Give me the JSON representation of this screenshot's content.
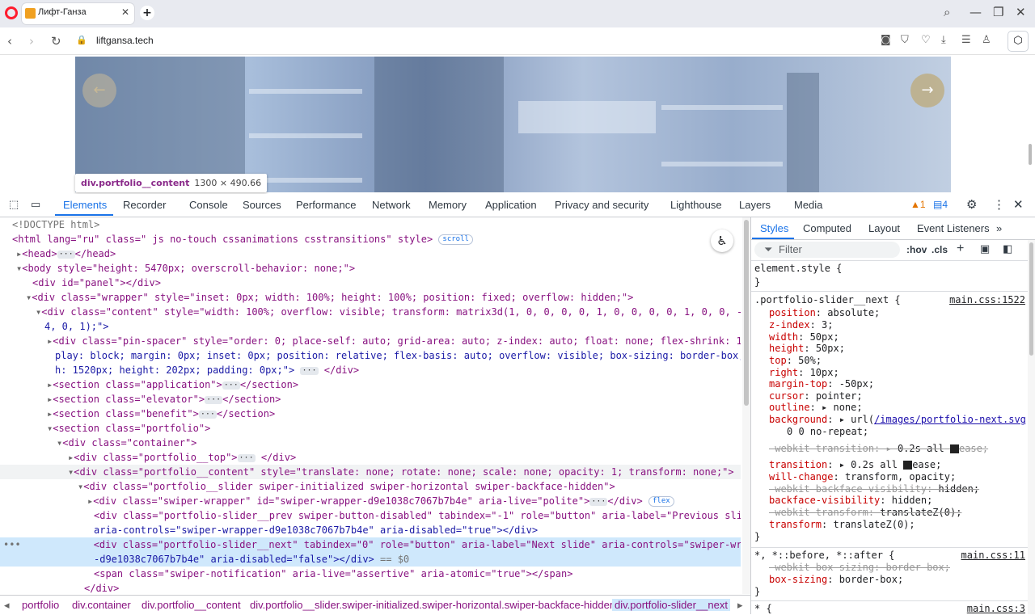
{
  "browser": {
    "tab_title": "Лифт-Ганза",
    "url": "liftgansa.tech",
    "new_tab": "+",
    "close_tab": "✕"
  },
  "page": {
    "tooltip_selector": "div.portfolio__content",
    "tooltip_size": "1300 × 490.66"
  },
  "devtools": {
    "tabs": [
      "Elements",
      "Recorder",
      "Console",
      "Sources",
      "Performance",
      "Network",
      "Memory",
      "Application",
      "Privacy and security",
      "Lighthouse",
      "Layers",
      "Media"
    ],
    "warnings_count": "1",
    "messages_count": "4",
    "breadcrumbs": [
      "portfolio",
      "div.container",
      "div.portfolio__content",
      "div.portfolio__slider.swiper-initialized.swiper-horizontal.swiper-backface-hidden",
      "div.portfolio-slider__next"
    ],
    "side_tabs": [
      "Styles",
      "Computed",
      "Layout",
      "Event Listeners"
    ],
    "filter_placeholder": "Filter",
    "hov": ":hov",
    "cls": ".cls",
    "dom_lines": [
      "<!DOCTYPE html>",
      "<html lang=\"ru\" class=\" js no-touch cssanimations csstransitions\" style>",
      "<head>",
      "</head>",
      "<body style=\"height: 5470px; overscroll-behavior: none;\">",
      "<div id=\"panel\"></div>",
      "<div class=\"wrapper\" style=\"inset: 0px; width: 100%; height: 100%; position: fixed; overflow: hidden;\">",
      "<div class=\"content\" style=\"width: 100%; overflow: visible; transform: matrix3d(1, 0, 0, 0, 0, 1, 0, 0, 0, 0, 1, 0, 0, -4254.",
      "4, 0, 1);\">",
      "<div class=\"pin-spacer\" style=\"order: 0; place-self: auto; grid-area: auto; z-index: auto; float: none; flex-shrink: 1; dis",
      "play: block; margin: 0px; inset: 0px; position: relative; flex-basis: auto; overflow: visible; box-sizing: border-box; widt",
      "h: 1520px; height: 202px; padding: 0px;\">",
      "</div>",
      "<section class=\"application\">",
      "</section>",
      "<section class=\"elevator\">",
      "</section>",
      "<section class=\"benefit\">",
      "</section>",
      "<section class=\"portfolio\">",
      "<div class=\"container\">",
      "<div class=\"portfolio__top\">",
      "</div>",
      "<div class=\"portfolio__content\" style=\"translate: none; rotate: none; scale: none; opacity: 1; transform: none;\">",
      "<div class=\"portfolio__slider swiper-initialized swiper-horizontal swiper-backface-hidden\">",
      "<div class=\"swiper-wrapper\" id=\"swiper-wrapper-d9e1038c7067b7b4e\" aria-live=\"polite\">",
      "</div>",
      "flex",
      "<div class=\"portfolio-slider__prev swiper-button-disabled\" tabindex=\"-1\" role=\"button\" aria-label=\"Previous slide\"",
      "aria-controls=\"swiper-wrapper-d9e1038c7067b7b4e\" aria-disabled=\"true\"></div>",
      "<div class=\"portfolio-slider__next\" tabindex=\"0\" role=\"button\" aria-label=\"Next slide\" aria-controls=\"swiper-wrapper",
      "-d9e1038c7067b7b4e\" aria-disabled=\"false\"></div>",
      "== $0",
      "<span class=\"swiper-notification\" aria-live=\"assertive\" aria-atomic=\"true\"></span>",
      "</div>",
      "scroll",
      "···"
    ],
    "styles": {
      "element_style": "element.style {",
      "rule1_selector": ".portfolio-slider__next {",
      "rule1_source": "main.css:1522",
      "rule1_props": [
        [
          "position",
          "absolute;"
        ],
        [
          "z-index",
          "3;"
        ],
        [
          "width",
          "50px;"
        ],
        [
          "height",
          "50px;"
        ],
        [
          "top",
          "50%;"
        ],
        [
          "right",
          "10px;"
        ],
        [
          "margin-top",
          "-50px;"
        ],
        [
          "cursor",
          "pointer;"
        ],
        [
          "outline",
          "none;"
        ],
        [
          "background",
          "url("
        ],
        [
          "-webkit-transition",
          "0.2s all"
        ],
        [
          "transition",
          "0.2s all"
        ],
        [
          "will-change",
          "transform, opacity;"
        ],
        [
          "-webkit-backface-visibility",
          "hidden;"
        ],
        [
          "backface-visibility",
          "hidden;"
        ],
        [
          "-webkit-transform",
          "translateZ(0);"
        ],
        [
          "transform",
          "translateZ(0);"
        ]
      ],
      "bg_url": "/images/portfolio-next.svg",
      "bg_rest": "0 0 no-repeat;",
      "ease": "ease;",
      "rule2_selector": "*, *::before, *::after {",
      "rule2_source": "main.css:11",
      "rule2_props": [
        [
          "-webkit-box-sizing",
          "border-box;"
        ],
        [
          "box-sizing",
          "border-box;"
        ]
      ],
      "rule3_selector": "* {",
      "rule3_source": "main.css:3",
      "close_brace": "}"
    }
  }
}
